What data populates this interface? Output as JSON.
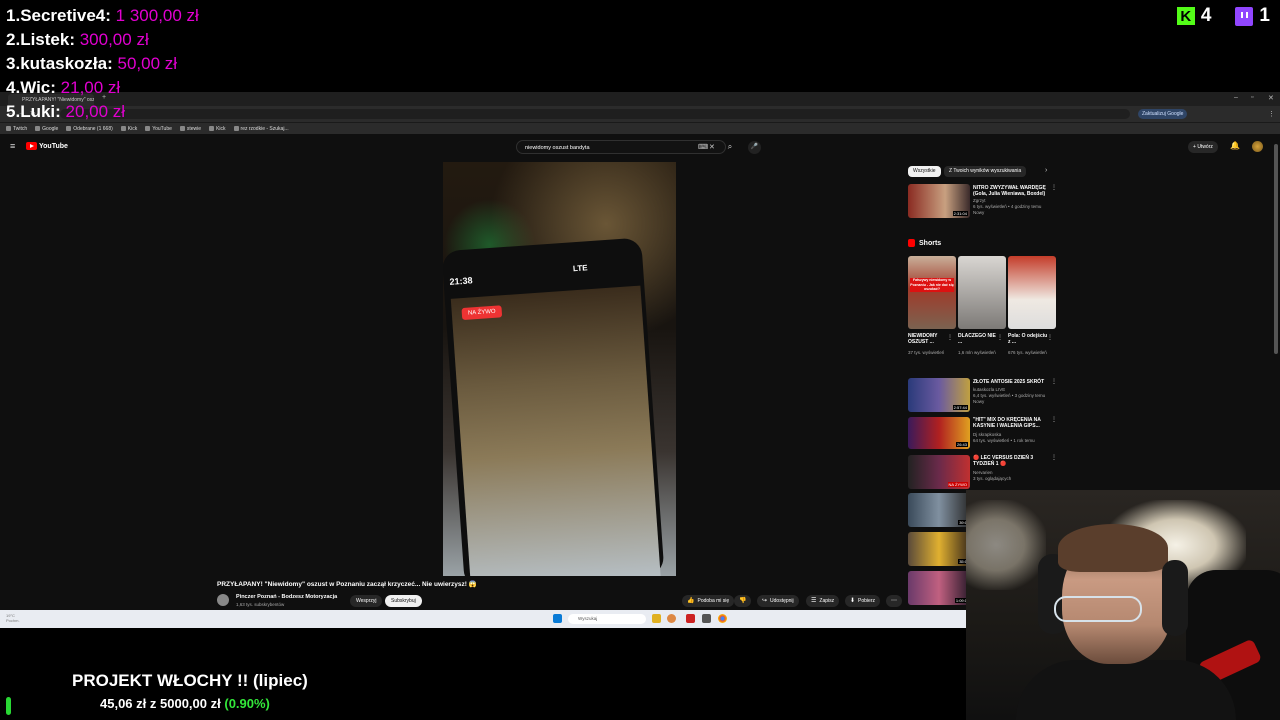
{
  "overlay": {
    "donations": [
      {
        "rank": "1.",
        "name": "Secretive4:",
        "amount": "1 300,00 zł"
      },
      {
        "rank": "2.",
        "name": "Listek:",
        "amount": "300,00 zł"
      },
      {
        "rank": "3.",
        "name": "kutaskozła:",
        "amount": "50,00 zł"
      },
      {
        "rank": "4.",
        "name": "Wic:",
        "amount": "21,00 zł"
      },
      {
        "rank": "5.",
        "name": "Luki:",
        "amount": "20,00 zł"
      }
    ],
    "counters": {
      "kick_letter": "K",
      "kick": "4",
      "twitch": "1"
    },
    "goal": {
      "title": "PROJEKT WŁOCHY !! (lipiec)",
      "current": "45,06 zł",
      "sep": "z",
      "target": "5000,00 zł",
      "percent": "(0.90%)",
      "progress_percent": 0.9
    }
  },
  "browser": {
    "tab_title": "PRZYŁAPANY! \"Niewidomy\" oszust w Poznaniu...",
    "update_label": "Zaktualizuj Google",
    "bookmarks": [
      "Twitch",
      "Google",
      "Odebrane (1 668)",
      "Kick",
      "YouTube",
      "stewie",
      "Kick",
      "rez rzodkie - Szukaj..."
    ]
  },
  "youtube": {
    "logo_text": "YouTube",
    "search_query": "niewidomy oszust bandyta",
    "create_label": "Utwórz",
    "video": {
      "phone_time": "21:38",
      "phone_status": "LTE",
      "live_label": "NA ŻYWO",
      "title": "PRZYŁAPANY! \"Niewidomy\" oszust w Poznaniu zaczął krzyczeć... Nie uwierzysz! 😱",
      "channel": "Pinczer Poznań - Bodzesz Motoryzacja",
      "subs": "1,63 tys. subskrybentów",
      "support": "Wesprzyj",
      "subscribe": "Subskrybuj",
      "actions": [
        {
          "icon": "👍",
          "label": "Podoba mi się"
        },
        {
          "icon": "👎",
          "label": ""
        },
        {
          "icon": "↪",
          "label": "Udostępnij"
        },
        {
          "icon": "☰",
          "label": "Zapisz"
        },
        {
          "icon": "⬇",
          "label": "Pobierz"
        },
        {
          "icon": "⋯",
          "label": ""
        }
      ]
    },
    "chips": [
      "Wszystkie",
      "Z Twoich wyników wyszukiwania"
    ],
    "top_rec": {
      "title": "NITRO ZWYZYWAŁ WARDĘGĘ (Gola, Julia Wieniawa, Boxdel)",
      "channel": "Zgrzyt",
      "meta": "6 tys. wyświetleń • 4 godziny temu",
      "badge": "Nowy",
      "duration": "2:31:04"
    },
    "shorts_label": "Shorts",
    "shorts": [
      {
        "title": "NIEWIDOMY OSZUST ...",
        "views": "37 tys. wyświetleń"
      },
      {
        "title": "DLACZEGO NIE ...",
        "views": "1,6 mln wyświetleń"
      },
      {
        "title": "Pola: O odejściu z ...",
        "views": "676 tys. wyświetleń"
      }
    ],
    "recs": [
      {
        "title": "ZŁOTE ANTOSIE 2025 SKRÓT",
        "channel": "kutaskozla LIVE",
        "meta": "6,4 tys. wyświetleń • 3 godziny temu",
        "badge": "Nowy",
        "duration": "2:57:44"
      },
      {
        "title": "\"HIT\" MIX DO KRĘCENIA NA KASYNIE I WALENIA GIPS...",
        "channel": "Dj skrapkoska",
        "meta": "64 tys. wyświetleń • 1 rok temu",
        "badge": "",
        "duration": "26:43"
      },
      {
        "title": "🔴 LEC VERSUS DZIEŃ 3 TYDZIEŃ 1 🔴",
        "channel": "Nervarien",
        "meta": "3 tys. oglądających",
        "badge": "",
        "duration": "NA ŻYWO"
      },
      {
        "title": "",
        "channel": "",
        "meta": "",
        "badge": "",
        "duration": "39:0"
      },
      {
        "title": "",
        "channel": "",
        "meta": "",
        "badge": "",
        "duration": "35:0"
      },
      {
        "title": "",
        "channel": "",
        "meta": "",
        "badge": "",
        "duration": "1:09:1"
      }
    ],
    "thumb_texts": {
      "short1": "Fałszywy niewidomy w Poznaniu - Jak nie dać się oszukać?"
    }
  },
  "taskbar": {
    "search_placeholder": "Wyszukaj",
    "tray": "19°C\nPochm."
  },
  "colors": {
    "donation_amount": "#e100d0",
    "goal_green": "#33e83a",
    "kick": "#53fc18",
    "twitch": "#9146ff",
    "yt_red": "#ff0000"
  }
}
